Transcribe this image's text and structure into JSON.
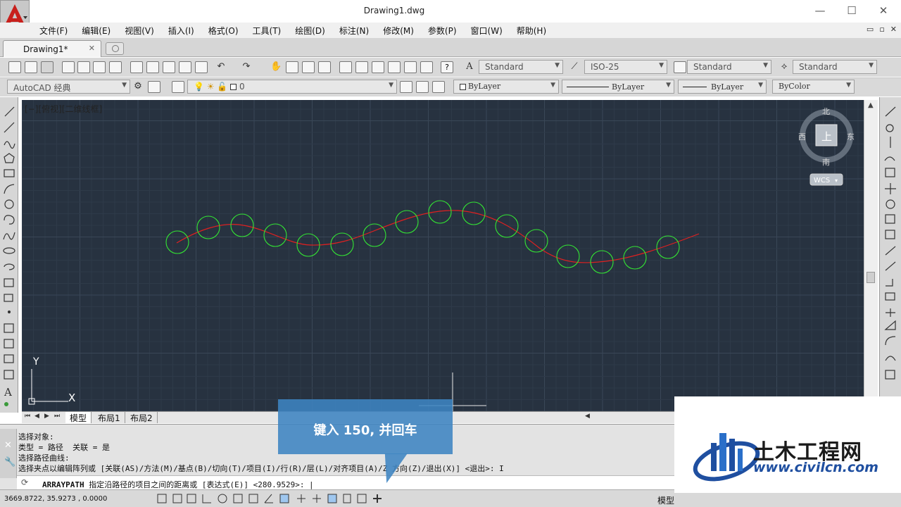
{
  "window": {
    "title": "Drawing1.dwg",
    "minimize_glyph": "—",
    "maximize_glyph": "☐",
    "close_glyph": "✕"
  },
  "menu": {
    "items": [
      "文件(F)",
      "编辑(E)",
      "视图(V)",
      "插入(I)",
      "格式(O)",
      "工具(T)",
      "绘图(D)",
      "标注(N)",
      "修改(M)",
      "参数(P)",
      "窗口(W)",
      "帮助(H)"
    ],
    "mdi_glyphs": [
      "▭",
      "▫",
      "✕"
    ]
  },
  "tabs": {
    "document": "Drawing1*",
    "close_glyph": "✕"
  },
  "toolbar1": {
    "text_style": "Standard",
    "dim_style": "ISO-25",
    "table_style": "Standard",
    "multileader_style": "Standard",
    "help_glyph": "?",
    "text_icon_glyph": "A"
  },
  "toolbar2": {
    "workspace": "AutoCAD 经典",
    "layer": "0",
    "color": "ByLayer",
    "linetype": "ByLayer",
    "lineweight": "ByLayer",
    "plot_style": "ByColor"
  },
  "viewport": {
    "label": "[−][俯视][二维线框]"
  },
  "viewcube": {
    "north": "北",
    "south": "南",
    "east": "东",
    "west": "西",
    "face": "上",
    "wcs": "WCS"
  },
  "ucs": {
    "x_label": "X",
    "y_label": "Y"
  },
  "layout_tabs": [
    "模型",
    "布局1",
    "布局2"
  ],
  "command": {
    "history": [
      "选择对象:",
      "类型 = 路径  关联 = 是",
      "选择路径曲线:",
      "选择夹点以编辑阵列或 [关联(AS)/方法(M)/基点(B)/切向(T)/项目(I)/行(R)/层(L)/对齐项目(A)/Z 方向(Z)/退出(X)] <退出>: I"
    ],
    "prompt_command": "ARRAYPATH",
    "prompt_text": " 指定沿路径的项目之间的距离或 [表达式(E)] <280.9529>: |",
    "close_glyph": "✕"
  },
  "status": {
    "coords": "3669.8722, 35.9273 , 0.0000",
    "mode": "模型"
  },
  "callout": {
    "text": "键入 150, 并回车"
  },
  "watermark": {
    "title": "土木工程网",
    "url": "www.civilcn.com"
  },
  "colors": {
    "canvas_bg": "#273240",
    "grid_minor": "#2e3a49",
    "grid_major": "#3a4757",
    "path_curve": "#e02020",
    "array_circles": "#33e633",
    "callout_bg": "#3d84c2"
  }
}
